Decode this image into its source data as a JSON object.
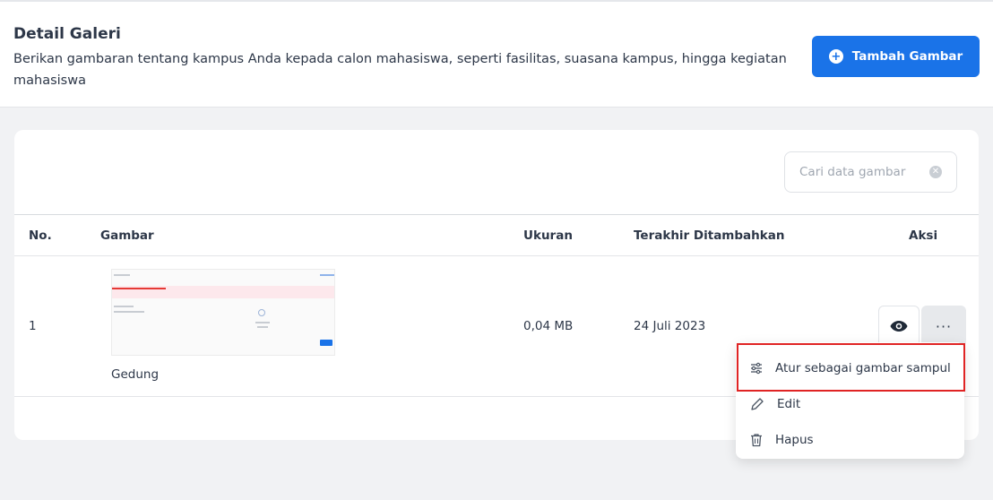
{
  "header": {
    "title": "Detail Galeri",
    "description": "Berikan gambaran tentang kampus Anda kepada calon mahasiswa, seperti fasilitas, suasana kampus, hingga kegiatan mahasiswa",
    "add_button_label": "Tambah Gambar"
  },
  "search": {
    "placeholder": "Cari data gambar"
  },
  "table": {
    "headers": {
      "no": "No.",
      "image": "Gambar",
      "size": "Ukuran",
      "last_added": "Terakhir Ditambahkan",
      "action": "Aksi"
    },
    "rows": [
      {
        "no": "1",
        "caption": "Gedung",
        "size": "0,04 MB",
        "date": "24 Juli 2023"
      }
    ]
  },
  "menu": {
    "items": [
      {
        "label": "Atur sebagai gambar sampul",
        "icon": "sliders-icon"
      },
      {
        "label": "Edit",
        "icon": "pencil-icon"
      },
      {
        "label": "Hapus",
        "icon": "trash-icon"
      }
    ]
  },
  "colors": {
    "primary": "#1a73e8",
    "highlight": "#e02424"
  }
}
